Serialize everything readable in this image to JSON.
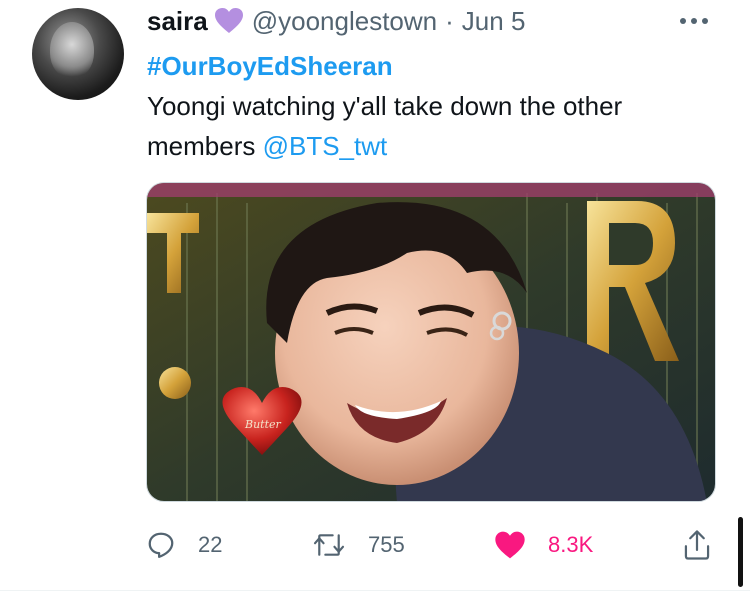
{
  "tweet": {
    "author": {
      "display_name": "saira",
      "name_emoji": "purple-heart-icon",
      "handle": "@yoonglestown",
      "separator": "·",
      "date": "Jun 5"
    },
    "hashtag": "#OurBoyEdSheeran",
    "text": "Yoongi watching y'all take down the other members",
    "mention": "@BTS_twt",
    "media": {
      "balloon_letter_right": "R",
      "heart_balloon_text": "Butter"
    },
    "actions": {
      "reply_count": "22",
      "retweet_count": "755",
      "like_count": "8.3K"
    }
  },
  "colors": {
    "link": "#1d9bf0",
    "like": "#f91880",
    "secondary_text": "#536471",
    "emoji_heart": "#b48fe0"
  },
  "icons": [
    "purple-heart-icon",
    "more-icon",
    "reply-icon",
    "retweet-icon",
    "like-heart-icon",
    "share-icon"
  ]
}
